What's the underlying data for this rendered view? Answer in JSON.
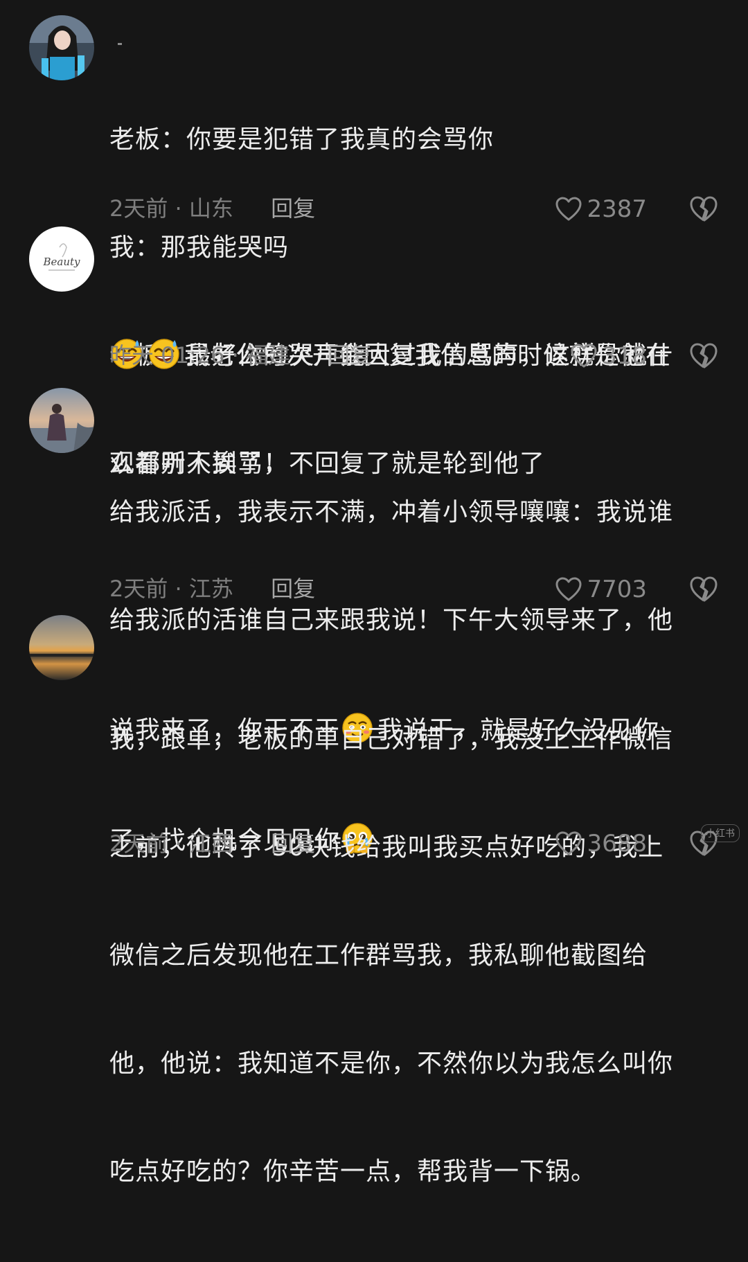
{
  "comments": [
    {
      "lines": [
        "老板：你要是犯错了我真的会骂你",
        "我：那我能哭吗",
        "老板：最好你的哭声能大过我的骂声，这样你就什",
        "么都听不到了！"
      ],
      "time": "2天前 · 山东",
      "reply": "回复",
      "likes": "2387"
    },
    {
      "lines": [
        "我老公每次开会回复我信息的时候就是他在",
        "观看别人挨骂，不回复了就是轮到他了"
      ],
      "time": "昨天 01:26 · 福建",
      "reply": "回复",
      "likes": "318"
    },
    {
      "lines": [
        "给我派活，我表示不满，冲着小领导嚷嚷：我说谁",
        "给我派的活谁自己来跟我说！下午大领导来了，他",
        "说我来了，你干不干",
        "我说干，就是好久没见你",
        "了，找个机会见见你"
      ],
      "time": "2天前 · 江苏",
      "reply": "回复",
      "likes": "7703"
    },
    {
      "lines": [
        "我，跟单，老板的单自己对错了，我没上工作微信",
        "之前，他转了 50块钱给我叫我买点好吃的，我上",
        "微信之后发现他在工作群骂我，我私聊他截图给",
        "他，他说：我知道不是你，不然你以为我怎么叫你",
        "吃点好吃的？你辛苦一点，帮我背一下锅。"
      ],
      "time": "2天前 · 江西",
      "reply": "回复",
      "likes": "3688"
    }
  ],
  "avatar2_text": "Beauty",
  "watermark": "小红书",
  "icons": {
    "like": "heart-outline-icon",
    "dislike": "broken-heart-icon",
    "emoji_sweat": "grinning-sweat-emoji",
    "emoji_blush": "smiling-blush-emoji",
    "emoji_pleading": "pleading-tears-emoji"
  },
  "colors": {
    "background": "#161616",
    "text": "#ededed",
    "meta": "#7f7f7f"
  }
}
